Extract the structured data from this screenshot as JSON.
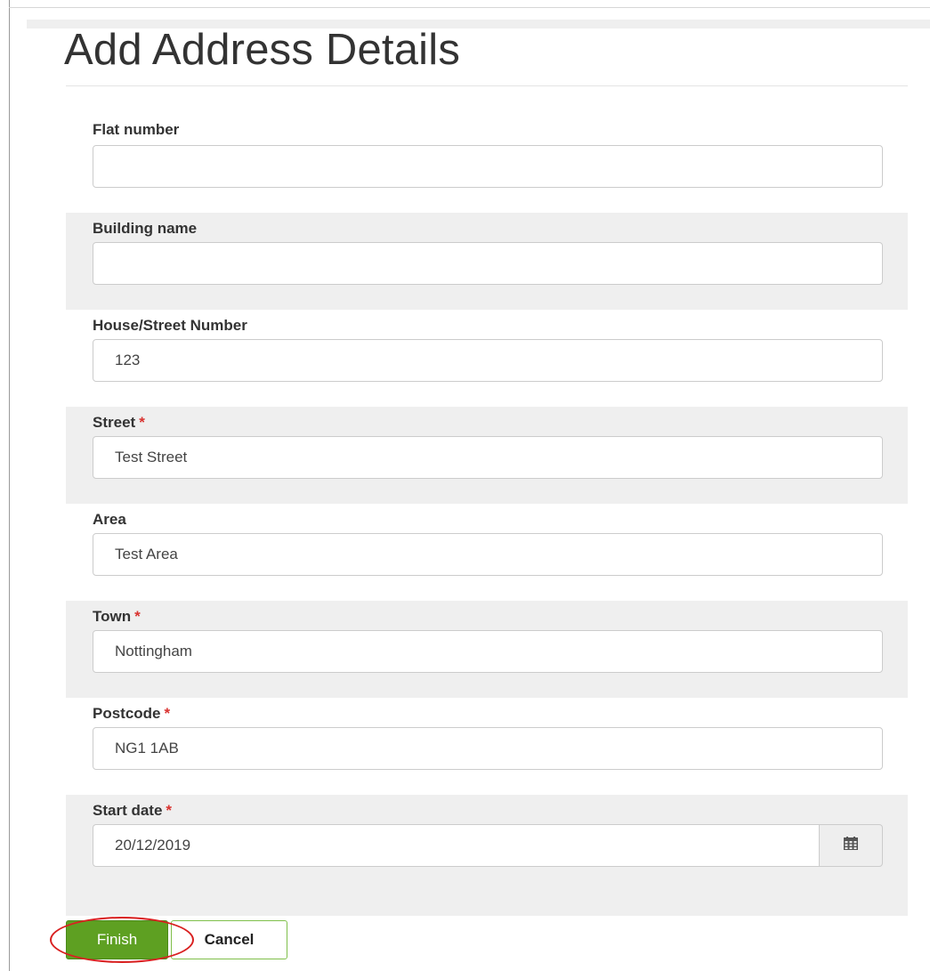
{
  "page": {
    "title": "Add Address Details"
  },
  "form": {
    "required_marker": "*",
    "fields": [
      {
        "label": "Flat number",
        "value": "",
        "required": false
      },
      {
        "label": "Building name",
        "value": "",
        "required": false
      },
      {
        "label": "House/Street Number",
        "value": "123",
        "required": false
      },
      {
        "label": "Street",
        "value": "Test Street",
        "required": true
      },
      {
        "label": "Area",
        "value": "Test Area",
        "required": false
      },
      {
        "label": "Town",
        "value": "Nottingham",
        "required": true
      },
      {
        "label": "Postcode",
        "value": "NG1 1AB",
        "required": true
      },
      {
        "label": "Start date",
        "value": "20/12/2019",
        "required": true,
        "icon": "calendar-icon"
      }
    ]
  },
  "actions": {
    "finish_label": "Finish",
    "cancel_label": "Cancel"
  },
  "colors": {
    "finish_bg": "#5ea022",
    "cancel_border": "#7fbf4a",
    "required_marker": "#d9322f",
    "annotation_ellipse": "#d92020",
    "shaded_row": "#efefef"
  }
}
